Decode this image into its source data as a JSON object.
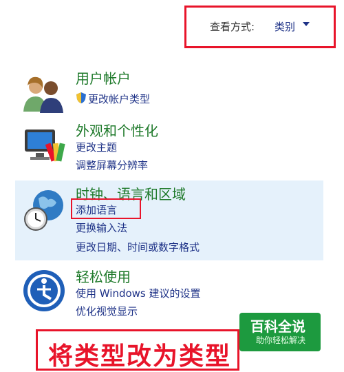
{
  "view": {
    "label": "查看方式:",
    "value": "类别"
  },
  "categories": [
    {
      "title": "用户帐户",
      "links": [
        "更改帐户类型"
      ]
    },
    {
      "title": "外观和个性化",
      "links": [
        "更改主题",
        "调整屏幕分辨率"
      ]
    },
    {
      "title": "时钟、语言和区域",
      "links": [
        "添加语言",
        "更换输入法",
        "更改日期、时间或数字格式"
      ]
    },
    {
      "title": "轻松使用",
      "links": [
        "使用 Windows 建议的设置",
        "优化视觉显示"
      ]
    }
  ],
  "annotation": {
    "text": "将类型改为类型"
  },
  "watermark": {
    "title": "百科全说",
    "subtitle": "助你轻松解决"
  },
  "colors": {
    "accent_red": "#e8142a",
    "title_green": "#1f7a2b",
    "link_blue": "#1e3287",
    "highlight": "#e5f1fb",
    "badge_green": "#1d9a3f"
  }
}
